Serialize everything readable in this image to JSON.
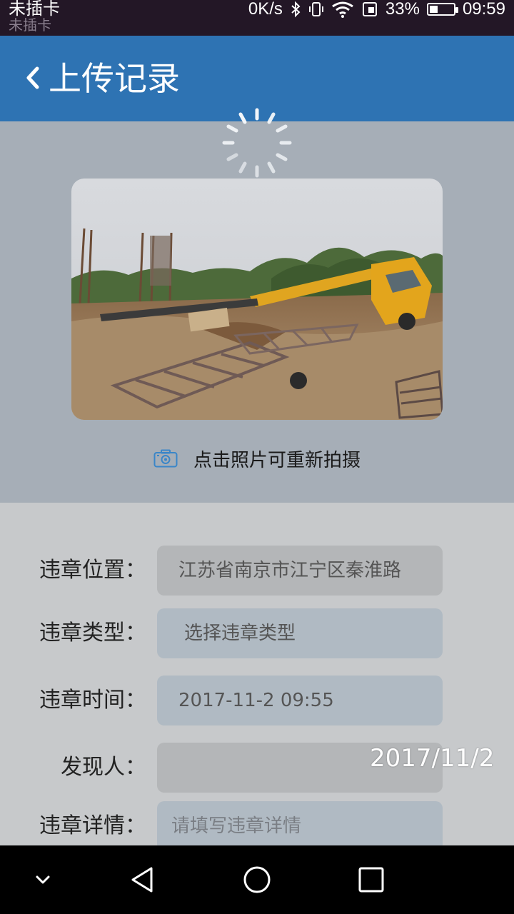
{
  "status_bar": {
    "carrier": "未插卡",
    "carrier_ghost": "未插卡",
    "speed": "0K/s",
    "battery_percent": "33%",
    "battery_level": 0.33,
    "time": "09:59"
  },
  "header": {
    "title": "上传记录"
  },
  "photo": {
    "retake_hint": "点击照片可重新拍摄"
  },
  "form": {
    "location_label": "违章位置：",
    "location_value": "江苏省南京市江宁区秦淮路",
    "type_label": "违章类型：",
    "type_placeholder": "选择违章类型",
    "time_label": "违章时间：",
    "time_value": "2017-11-2 09:55",
    "finder_label": "发现人：",
    "finder_value": "",
    "details_label": "违章详情：",
    "details_placeholder": "请填写违章详情"
  },
  "overlay": {
    "date_stamp": "2017/11/2"
  },
  "colors": {
    "app_bar": "#2e73b3",
    "status_bar": "#231726",
    "photo_section_bg": "#a6aeb7",
    "form_bg": "#c7c9cb",
    "camera_icon": "#3a86c8"
  },
  "icons": {
    "back": "chevron-left-icon",
    "loading": "spinner-icon",
    "camera": "camera-icon",
    "nav_hide": "chevron-down-icon",
    "nav_back": "triangle-back-icon",
    "nav_home": "circle-home-icon",
    "nav_recents": "square-recents-icon"
  }
}
